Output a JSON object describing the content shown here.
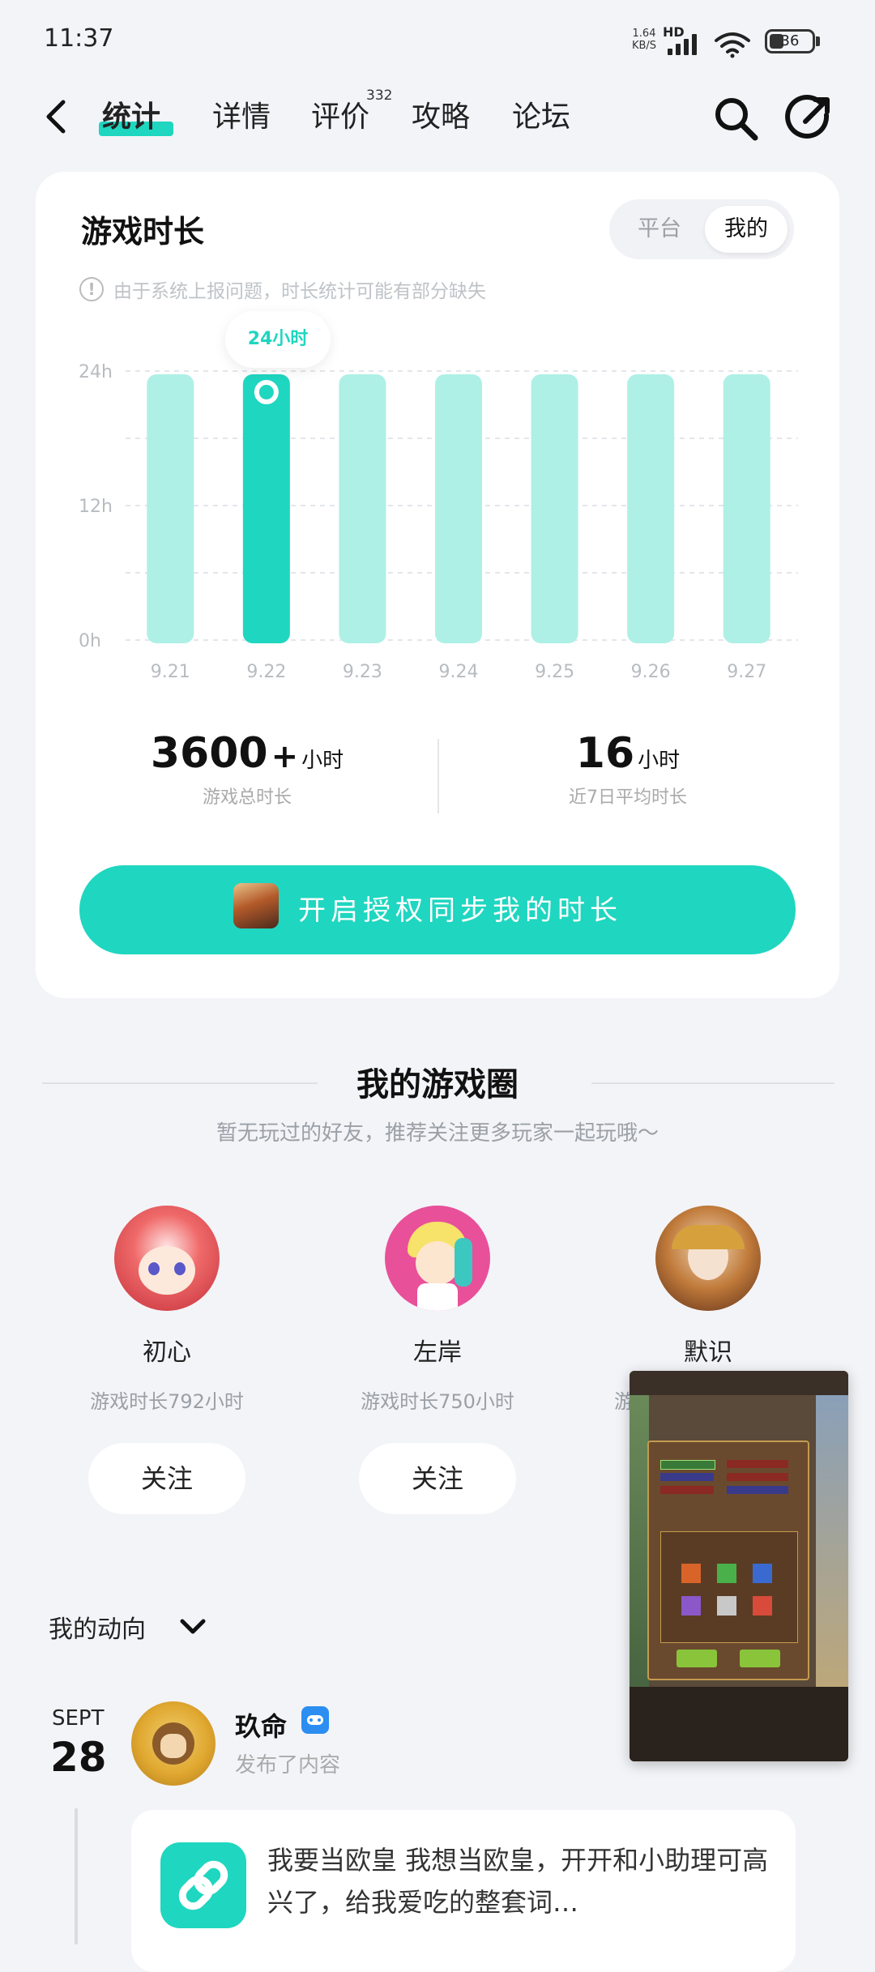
{
  "status": {
    "time": "11:37",
    "net_speed_top": "1.64",
    "net_speed_unit": "KB/S",
    "hd": "HD",
    "battery": "36"
  },
  "nav": {
    "tabs": [
      {
        "label": "统计"
      },
      {
        "label": "详情"
      },
      {
        "label": "评价"
      },
      {
        "label": "攻略"
      },
      {
        "label": "论坛"
      }
    ],
    "review_count": "332"
  },
  "stats": {
    "title": "游戏时长",
    "toggle_platform": "平台",
    "toggle_mine": "我的",
    "notice": "由于系统上报问题，时长统计可能有部分缺失",
    "tooltip": "24小时",
    "total_value": "3600",
    "total_plus": "+",
    "total_unit": "小时",
    "total_label": "游戏总时长",
    "avg_value": "16",
    "avg_unit": "小时",
    "avg_label": "近7日平均时长",
    "sync_button": "开启授权同步我的时长"
  },
  "chart_data": {
    "type": "bar",
    "categories": [
      "9.21",
      "9.22",
      "9.23",
      "9.24",
      "9.25",
      "9.26",
      "9.27"
    ],
    "values": [
      24,
      24,
      24,
      24,
      24,
      24,
      24
    ],
    "highlighted_index": 1,
    "y_ticks": [
      "0h",
      "12h",
      "24h"
    ],
    "ylim": [
      0,
      24
    ],
    "colors": {
      "bar": "#aef0e6",
      "highlight": "#1fd6c0"
    },
    "grid": true
  },
  "circle": {
    "title": "我的游戏圈",
    "subtitle": "暂无玩过的好友，推荐关注更多玩家一起玩哦～",
    "friends": [
      {
        "name": "初心",
        "time": "游戏时长792小时",
        "follow": "关注"
      },
      {
        "name": "左岸",
        "time": "游戏时长750小时",
        "follow": "关注"
      },
      {
        "name": "默识",
        "time": "游",
        "follow": ""
      }
    ]
  },
  "activity": {
    "title": "我的动向",
    "month": "SEPT",
    "day": "28",
    "user": "玖命",
    "action": "发布了内容",
    "post_text": "我要当欧皇 我想当欧皇，开开和小助理可高兴了，给我爱吃的整套词…"
  },
  "colors": {
    "accent": "#1fd6c0",
    "background": "#f3f4f8"
  }
}
